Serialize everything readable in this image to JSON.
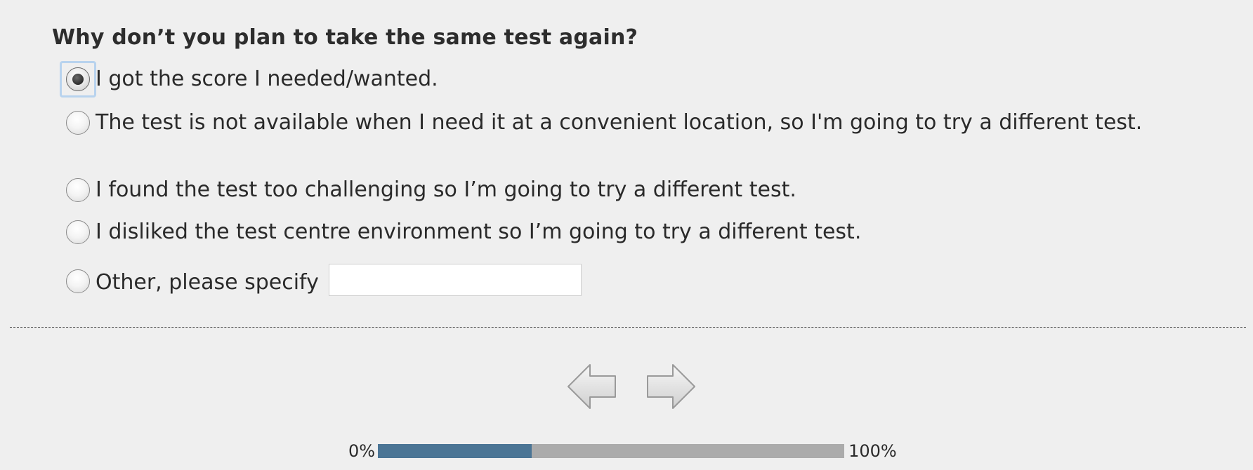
{
  "question": {
    "text": "Why don’t you plan to take the same test again?"
  },
  "options": [
    {
      "label": "I got the score I needed/wanted.",
      "checked": true
    },
    {
      "label": "The test is not available when I need it at a convenient location, so I'm going to try a different test.",
      "checked": false
    },
    {
      "label": "I found the test too challenging so I’m going to try a different test.",
      "checked": false
    },
    {
      "label": "I disliked the test centre environment so I’m going to try a different test.",
      "checked": false
    },
    {
      "label": "Other, please specify",
      "checked": false
    }
  ],
  "other_input": {
    "value": "",
    "placeholder": ""
  },
  "navigation": {
    "back_icon": "arrow-left-icon",
    "next_icon": "arrow-right-icon"
  },
  "progress": {
    "start_label": "0%",
    "end_label": "100%",
    "fraction": 0.33,
    "fill_color": "#4b7595",
    "track_color": "#ababab"
  }
}
